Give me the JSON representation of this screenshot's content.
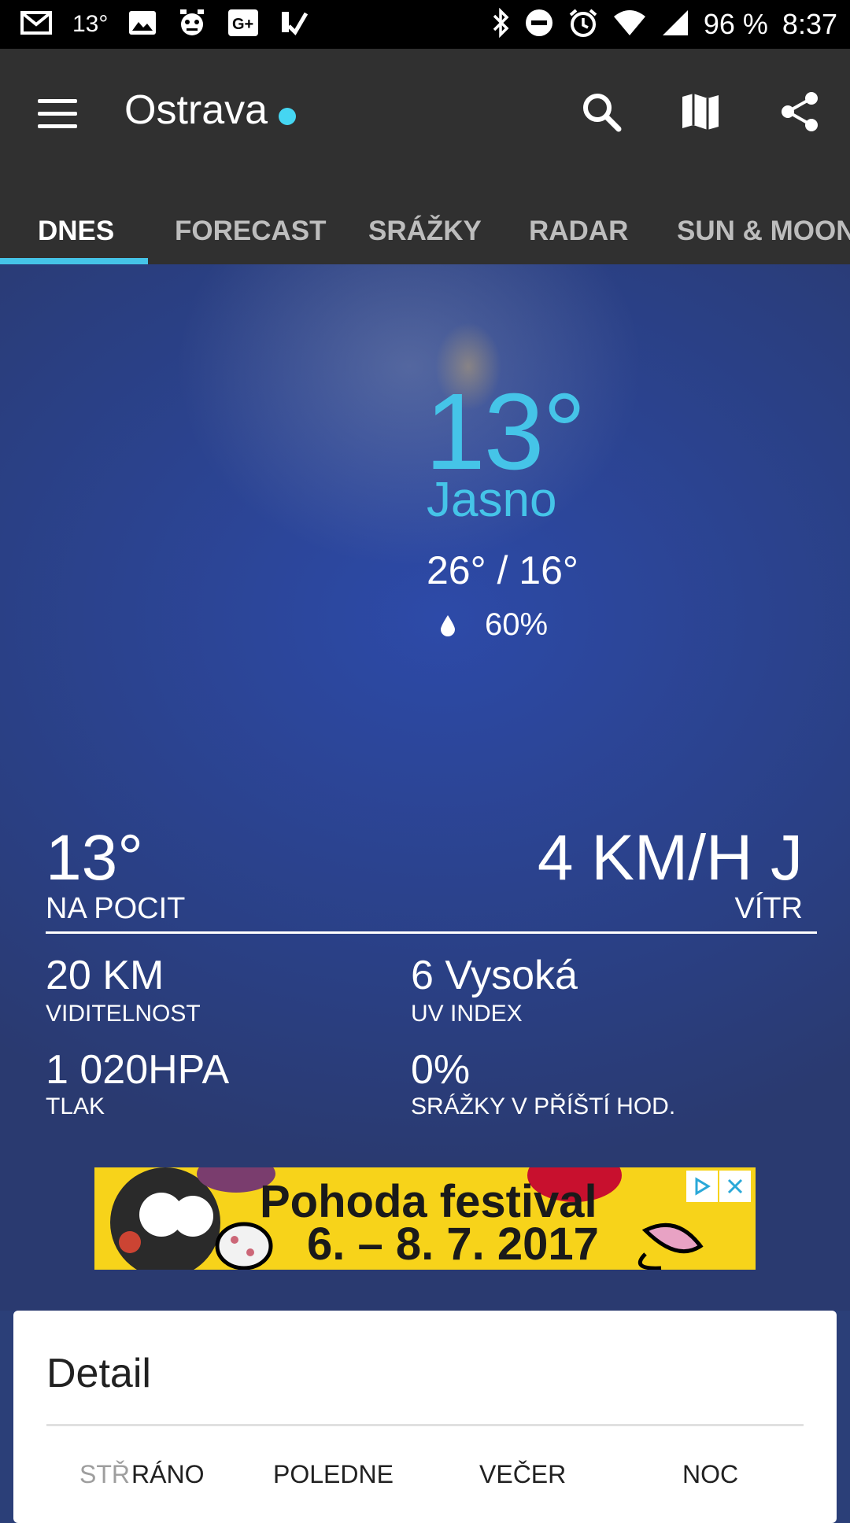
{
  "status_bar": {
    "notif_temp": "13°",
    "battery": "96 %",
    "time": "8:37"
  },
  "app_bar": {
    "city": "Ostrava",
    "tabs": [
      {
        "label": "DNES",
        "active": true
      },
      {
        "label": "FORECAST",
        "active": false
      },
      {
        "label": "SRÁŽKY",
        "active": false
      },
      {
        "label": "RADAR",
        "active": false
      },
      {
        "label": "SUN & MOON",
        "active": false
      }
    ]
  },
  "current": {
    "temp": "13°",
    "condition": "Jasno",
    "high_low": "26° / 16°",
    "precip_chance": "60%"
  },
  "details": {
    "feels_like_value": "13°",
    "feels_like_label": "NA POCIT",
    "wind_value": "4 KM/H J",
    "wind_label": "VÍTR",
    "visibility_value": "20 KM",
    "visibility_label": "VIDITELNOST",
    "uv_value": "6 Vysoká",
    "uv_label": "UV INDEX",
    "pressure_value": "1 020HPA",
    "pressure_label": "TLAK",
    "precip_value": "0%",
    "precip_label": "SRÁŽKY V PŘÍŠTÍ HOD."
  },
  "ad": {
    "title": "Pohoda festival",
    "dates": "6. – 8. 7. 2017"
  },
  "detail_card": {
    "title": "Detail",
    "day": "STŘ",
    "columns": [
      "RÁNO",
      "POLEDNE",
      "VEČER",
      "NOC"
    ]
  },
  "colors": {
    "accent": "#45c4e8",
    "app_bar": "#303030",
    "ad_background": "#f7d31a"
  }
}
